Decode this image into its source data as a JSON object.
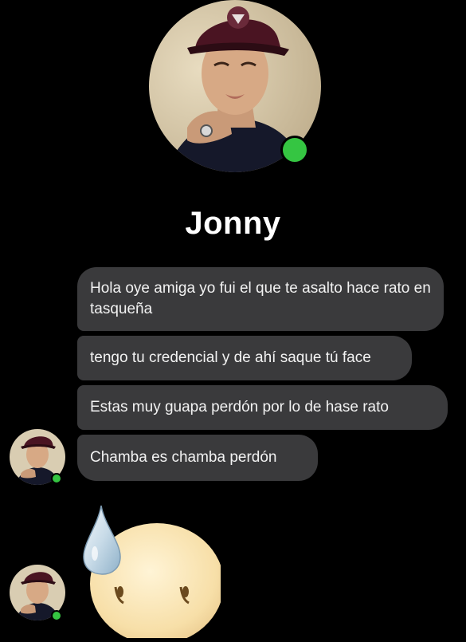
{
  "contact": {
    "name": "Jonny",
    "status": "online",
    "online_color": "#35c542"
  },
  "messages": [
    {
      "text": "Hola oye amiga yo fui el que te asalto hace rato en tasqueña"
    },
    {
      "text": "tengo tu credencial y de ahí saque tú face"
    },
    {
      "text": "Estas muy guapa perdón por lo de hase rato"
    },
    {
      "text": "Chamba es chamba perdón"
    }
  ],
  "sticker": {
    "icon": "sweat-drop-sad-face-icon"
  },
  "colors": {
    "background": "#000000",
    "bubble": "#3a3a3c",
    "text": "#f2f2f2"
  }
}
